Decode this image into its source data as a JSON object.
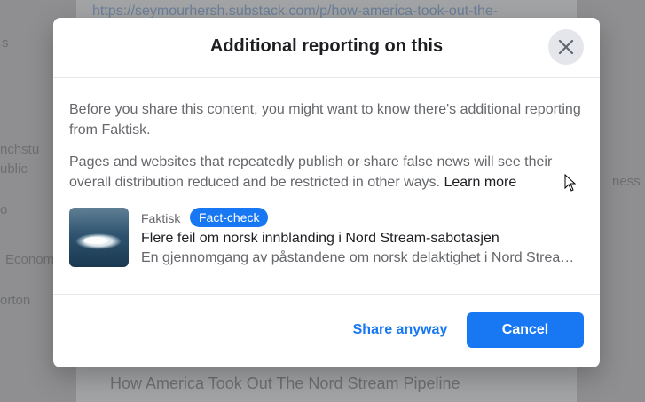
{
  "background": {
    "url_text": "https://seymourhersh.substack.com/p/how-america-took-out-the-",
    "side_fragments": [
      "s",
      "nchstu",
      "ublic",
      "o",
      "Econom",
      "orton",
      "ness"
    ],
    "bottom_title": "How America Took Out The Nord Stream Pipeline"
  },
  "dialog": {
    "title": "Additional reporting on this",
    "close_icon": "close-icon",
    "paragraph1": "Before you share this content, you might want to know there's additional reporting from Faktisk.",
    "paragraph2": "Pages and websites that repeatedly publish or share false news will see their overall distribution reduced and be restricted in other ways.",
    "learn_more": "Learn more",
    "article": {
      "source": "Faktisk",
      "badge": "Fact-check",
      "title": "Flere feil om norsk innblanding i Nord Stream-sabotasjen",
      "description": "En gjennomgang av påstandene om norsk delaktighet i Nord Stream-sabotasjen"
    },
    "buttons": {
      "share_anyway": "Share anyway",
      "cancel": "Cancel"
    }
  },
  "colors": {
    "accent": "#1877f2",
    "title_text": "#1c1e21",
    "secondary_text": "#65676b",
    "overlay": "#8f8f91"
  }
}
